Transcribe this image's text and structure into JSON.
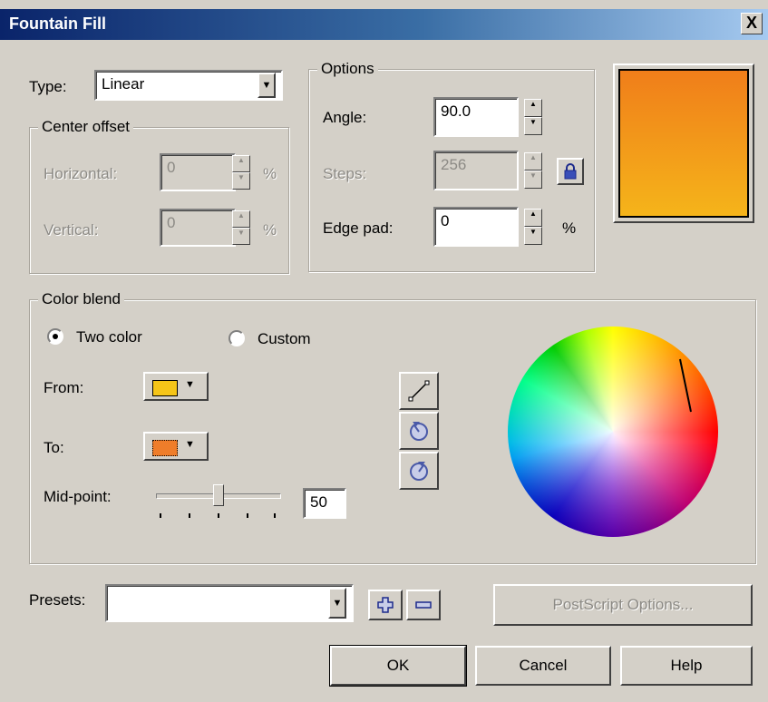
{
  "window": {
    "title": "Fountain Fill",
    "close_glyph": "X"
  },
  "type": {
    "label": "Type:",
    "value": "Linear"
  },
  "center_offset": {
    "legend": "Center offset",
    "horizontal_label": "Horizontal:",
    "horizontal_value": "0",
    "vertical_label": "Vertical:",
    "vertical_value": "0",
    "unit": "%"
  },
  "options": {
    "legend": "Options",
    "angle_label": "Angle:",
    "angle_value": "90.0",
    "steps_label": "Steps:",
    "steps_value": "256",
    "edge_pad_label": "Edge pad:",
    "edge_pad_value": "0",
    "unit": "%"
  },
  "preview": {
    "gradient_top": "#f07e1a",
    "gradient_bottom": "#f5b41a",
    "border": "#000000"
  },
  "color_blend": {
    "legend": "Color blend",
    "two_color_label": "Two color",
    "custom_label": "Custom",
    "selected": "two_color",
    "from_label": "From:",
    "from_color": "#f5c518",
    "to_label": "To:",
    "to_color": "#ef7d2a",
    "midpoint_label": "Mid-point:",
    "midpoint_value": "50",
    "midpoint_fraction": 0.5,
    "direction_icons": [
      "direct-line-icon",
      "counter-clockwise-icon",
      "clockwise-icon"
    ]
  },
  "presets": {
    "label": "Presets:",
    "value": ""
  },
  "buttons": {
    "postscript": "PostScript Options...",
    "ok": "OK",
    "cancel": "Cancel",
    "help": "Help"
  }
}
